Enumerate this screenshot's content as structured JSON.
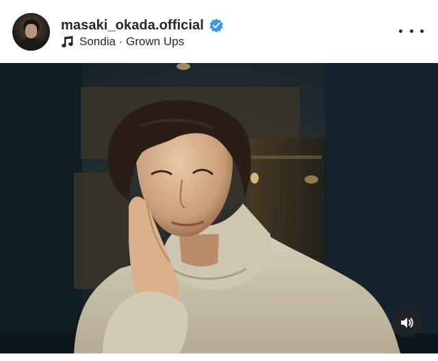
{
  "post": {
    "username": "masaki_okada.official",
    "verified": true,
    "audio": "Sondia · Grown Ups"
  },
  "icons": {
    "verified": "verified-badge-icon",
    "music": "music-note-icon",
    "more": "more-options-icon",
    "sound": "speaker-icon"
  },
  "colors": {
    "text": "#262626",
    "verified_blue": "#3897f0",
    "overlay_button": "#262626"
  }
}
